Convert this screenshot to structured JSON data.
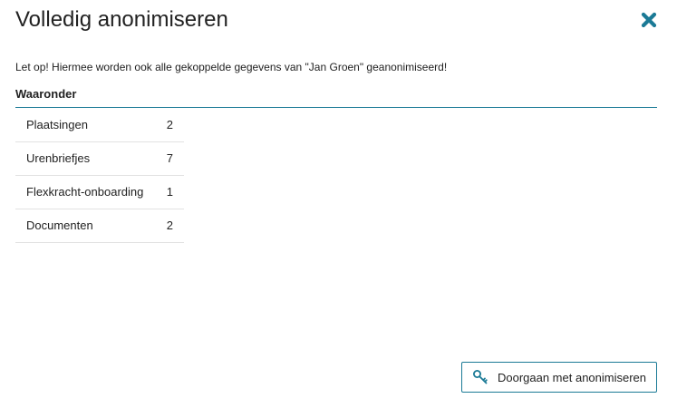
{
  "dialog": {
    "title": "Volledig anonimiseren",
    "close_icon": "close-x-icon",
    "warning": "Let op! Hiermee worden ook alle gekoppelde gegevens van \"Jan Groen\" geanonimiseerd!",
    "section_title": "Waaronder",
    "rows": [
      {
        "label": "Plaatsingen",
        "count": "2"
      },
      {
        "label": "Urenbriefjes",
        "count": "7"
      },
      {
        "label": "Flexkracht-onboarding",
        "count": "1"
      },
      {
        "label": "Documenten",
        "count": "2"
      }
    ],
    "continue_button": {
      "label": "Doorgaan met anonimiseren",
      "icon": "key-icon"
    }
  },
  "colors": {
    "accent": "#1b7a96",
    "divider": "#e2e2e2",
    "text": "#222222"
  }
}
